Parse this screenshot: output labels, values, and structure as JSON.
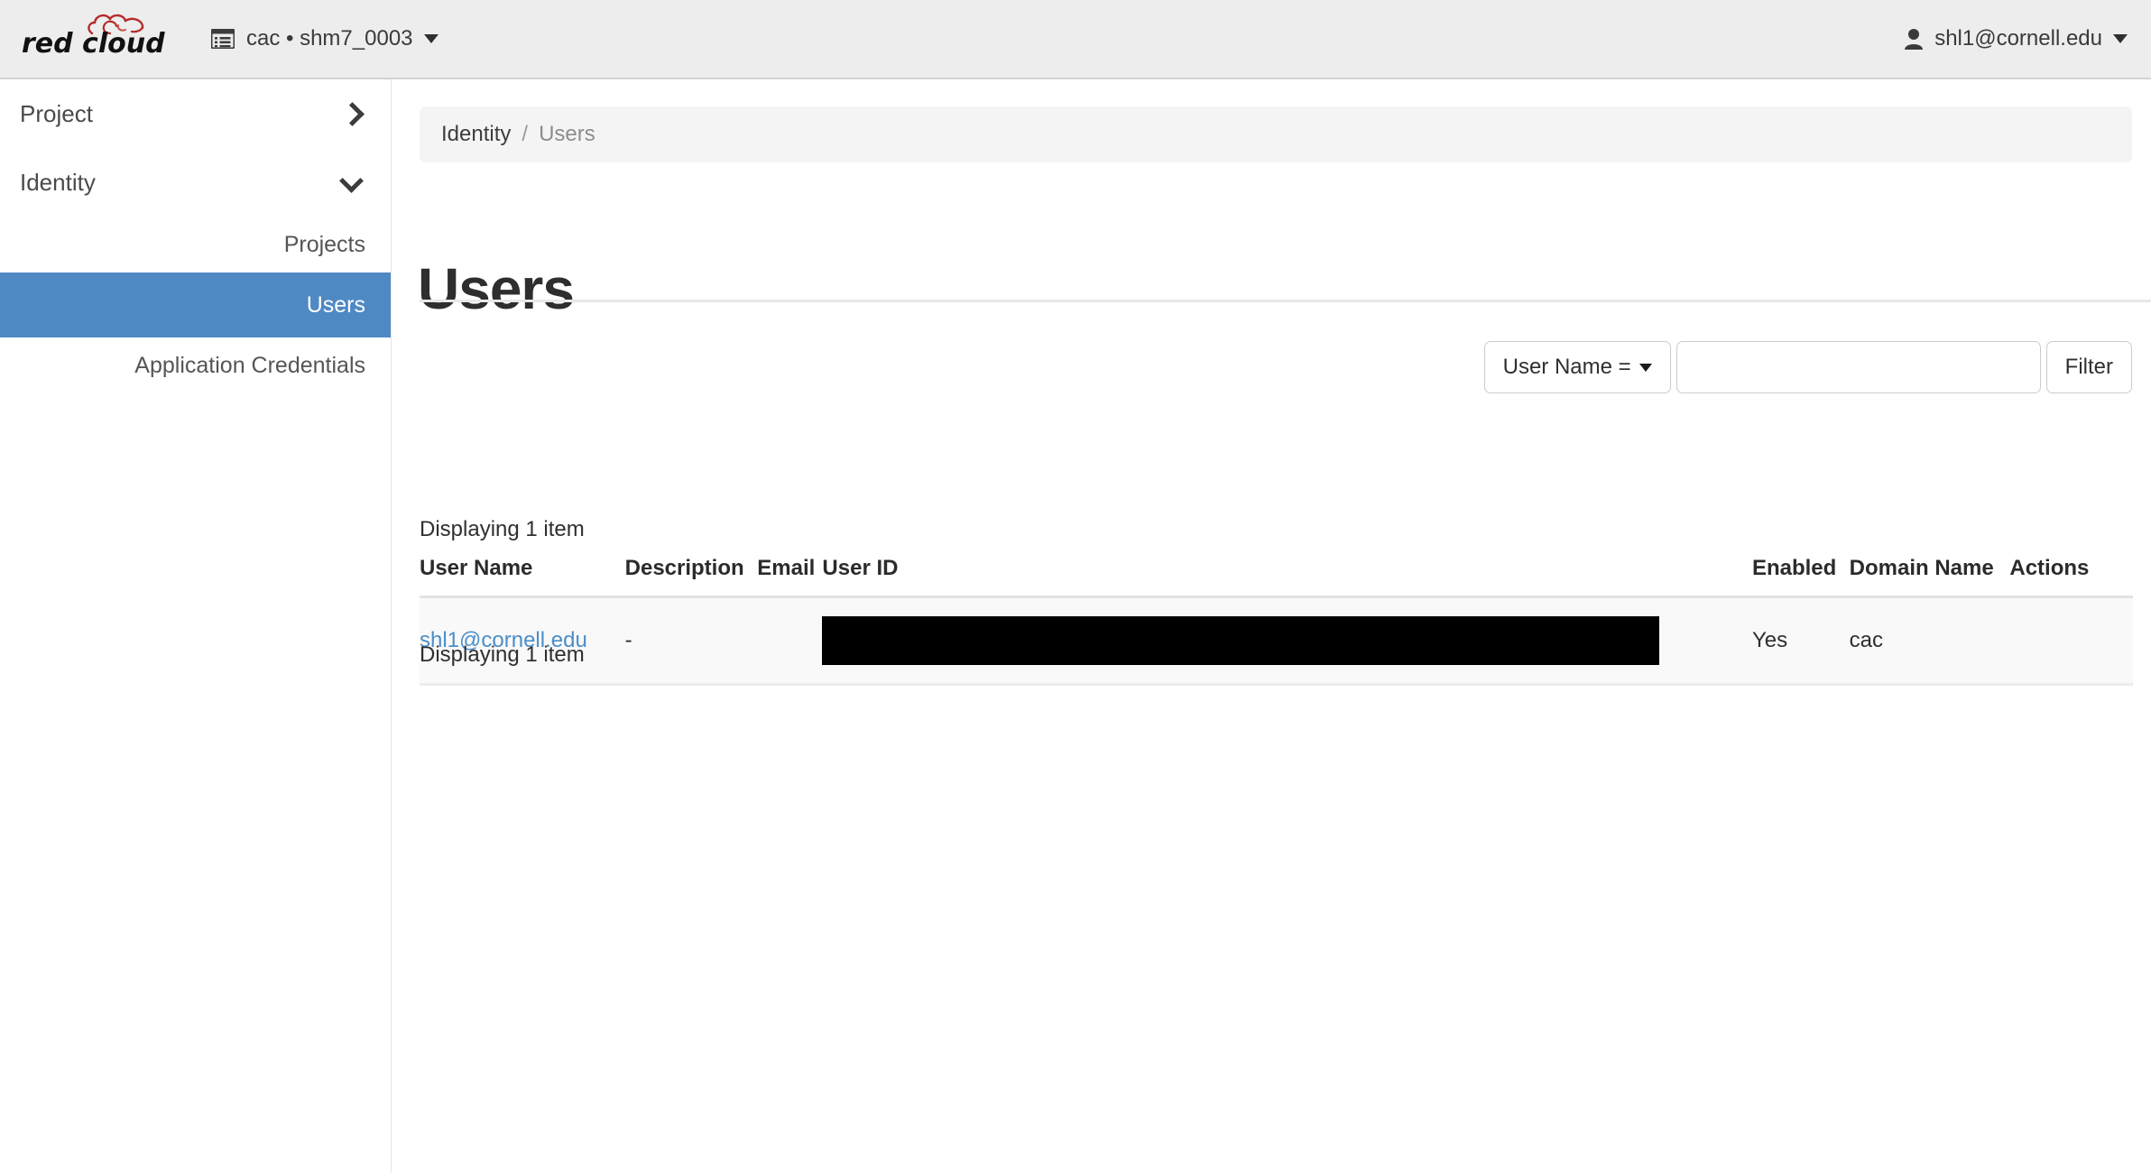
{
  "header": {
    "logo_text": "red cloud",
    "logo_icon": "red-cloud-logo",
    "project_switcher": {
      "icon": "list-grid-icon",
      "label": "cac • shm7_0003",
      "caret_icon": "caret-down-icon"
    },
    "user_menu": {
      "icon": "user-person-icon",
      "label": "shl1@cornell.edu",
      "caret_icon": "caret-down-icon"
    }
  },
  "sidebar": {
    "groups": [
      {
        "label": "Project",
        "icon": "chevron-right-icon",
        "expanded": false
      },
      {
        "label": "Identity",
        "icon": "chevron-down-icon",
        "expanded": true
      }
    ],
    "items": [
      {
        "label": "Projects",
        "active": false
      },
      {
        "label": "Users",
        "active": true
      },
      {
        "label": "Application Credentials",
        "active": false
      }
    ],
    "active_color": "#4f89c4"
  },
  "breadcrumb": {
    "parent": "Identity",
    "separator": "/",
    "current": "Users"
  },
  "main": {
    "title": "Users",
    "count_top": "Displaying 1 item",
    "count_bottom": "Displaying 1 item"
  },
  "toolbar": {
    "filter_field_label": "User Name =",
    "filter_field_caret": "caret-down-icon",
    "search_value": "",
    "search_placeholder": "",
    "filter_button_label": "Filter"
  },
  "table": {
    "columns": [
      {
        "key": "user_name",
        "label": "User Name"
      },
      {
        "key": "description",
        "label": "Description"
      },
      {
        "key": "email",
        "label": "Email"
      },
      {
        "key": "user_id",
        "label": "User ID"
      },
      {
        "key": "enabled",
        "label": "Enabled"
      },
      {
        "key": "domain_name",
        "label": "Domain Name"
      },
      {
        "key": "actions",
        "label": "Actions"
      }
    ],
    "rows": [
      {
        "user_name": "shl1@cornell.edu",
        "description": "-",
        "email": "",
        "user_id": "",
        "user_id_redacted": true,
        "enabled": "Yes",
        "domain_name": "cac",
        "actions": ""
      }
    ]
  },
  "colors": {
    "header_bg": "#ededed",
    "sidebar_active": "#4f89c4",
    "link": "#4b8ec9",
    "row_bg": "#f9f9f9",
    "breadcrumb_bg": "#f4f4f4",
    "redaction": "#000000"
  }
}
